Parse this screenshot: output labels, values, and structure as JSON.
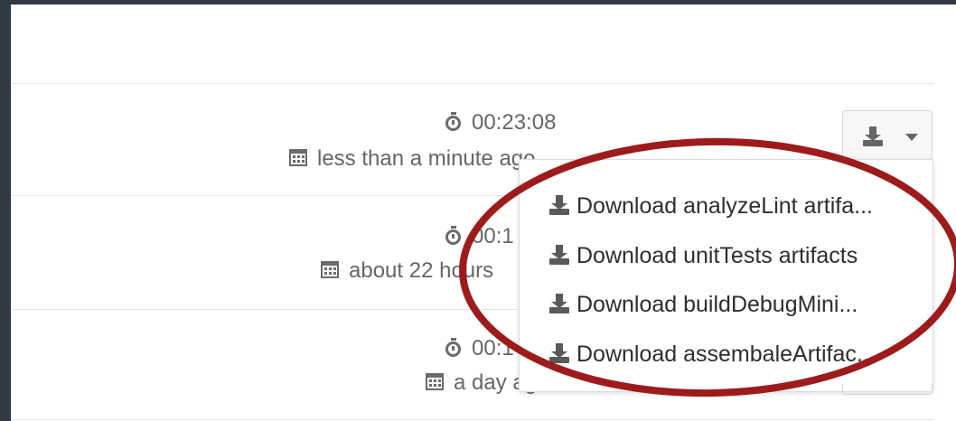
{
  "rows": [
    {
      "duration": "00:23:08",
      "created": "less than a minute ago"
    },
    {
      "duration": "00:1",
      "created": "about 22 hours"
    },
    {
      "duration": "00:1",
      "created": "a day ago"
    }
  ],
  "download_menu": {
    "items": [
      "Download analyzeLint artifa...",
      "Download unitTests artifacts",
      "Download buildDebugMini...",
      "Download assembaleArtifac..."
    ]
  },
  "annotation": {
    "highlight_color": "#9e1b1b"
  },
  "icons": {
    "duration": "stopwatch-icon",
    "created": "calendar-icon",
    "download": "download-icon",
    "dropdown": "caret-down-icon"
  }
}
